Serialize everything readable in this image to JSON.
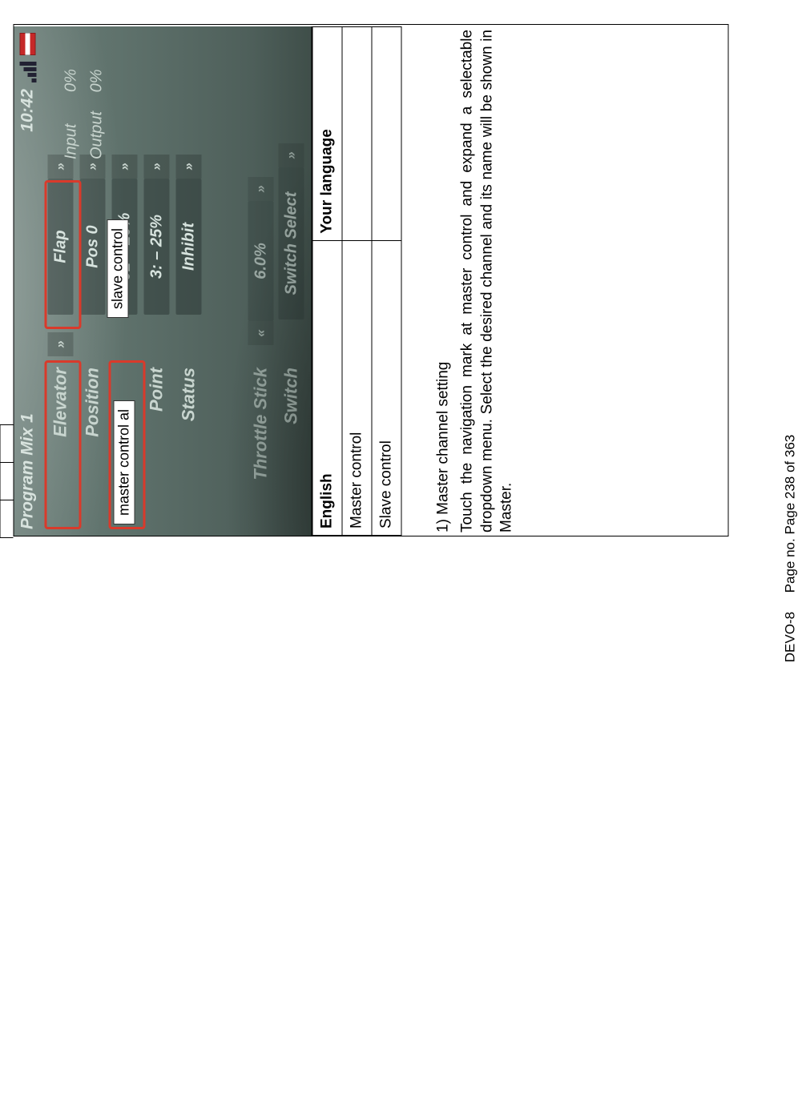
{
  "screen": {
    "title": "Program Mix 1",
    "clock": "10:42",
    "rows": {
      "master": {
        "label": "Elevator",
        "value": "Flap"
      },
      "position": {
        "label": "Position",
        "value": "Pos 0"
      },
      "offset": {
        "label": "",
        "value": "51 – 25%"
      },
      "point": {
        "label": "Point",
        "value": "3: – 25%"
      },
      "status": {
        "label": "Status",
        "value": "Inhibit"
      },
      "thstick": {
        "label": "Throttle Stick",
        "value": "6.0%"
      },
      "switch": {
        "label": "Switch",
        "value": "Switch Select"
      }
    },
    "side": {
      "input": "Input",
      "inputVal": "0%",
      "output": "Output",
      "outputVal": "0%"
    },
    "callouts": {
      "master": "master control al",
      "slave": "slave control"
    }
  },
  "table": {
    "h1": "English",
    "h2": "Your language",
    "r1": "Master control",
    "r2": "Slave control"
  },
  "text": {
    "heading": "1)  Master channel setting",
    "para": "Touch the navigation mark at master control and expand a selectable dropdown menu. Select the desired channel and its name will be shown in Master."
  },
  "footer": {
    "left": "DEVO-8",
    "right": "Page no. Page 238 of 363"
  }
}
